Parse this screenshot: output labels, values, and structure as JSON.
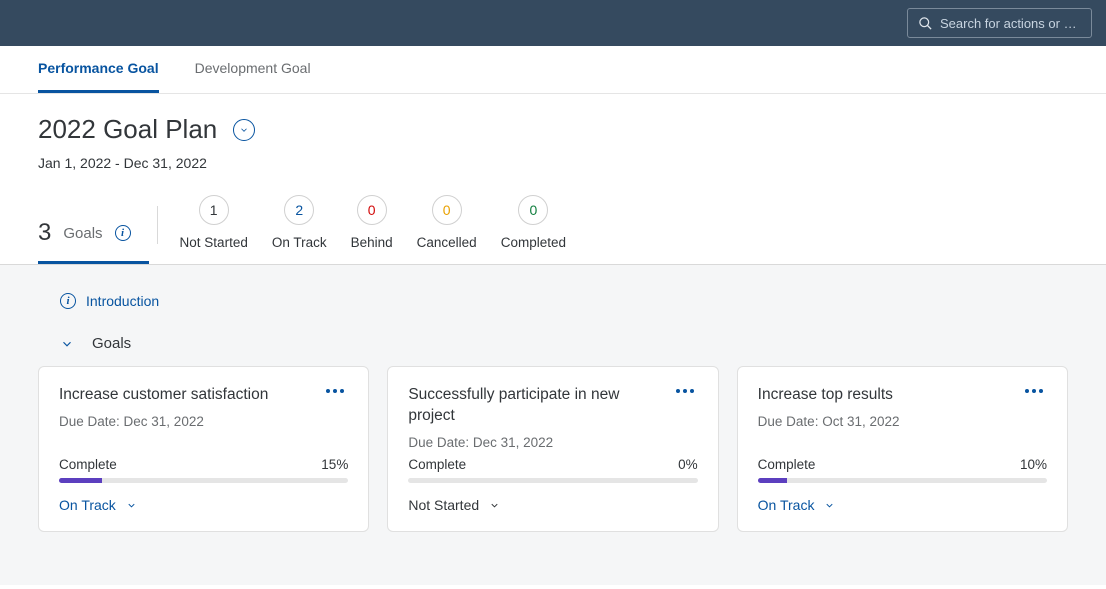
{
  "search": {
    "placeholder": "Search for actions or peo..."
  },
  "tabs": {
    "performance": "Performance Goal",
    "development": "Development Goal"
  },
  "header": {
    "title": "2022 Goal Plan",
    "date_range": "Jan 1, 2022 - Dec 31, 2022"
  },
  "summary": {
    "count": "3",
    "label": "Goals",
    "statuses": [
      {
        "count": "1",
        "label": "Not Started",
        "color": "c-black"
      },
      {
        "count": "2",
        "label": "On Track",
        "color": "c-blue"
      },
      {
        "count": "0",
        "label": "Behind",
        "color": "c-red"
      },
      {
        "count": "0",
        "label": "Cancelled",
        "color": "c-orange"
      },
      {
        "count": "0",
        "label": "Completed",
        "color": "c-green"
      }
    ]
  },
  "intro_label": "Introduction",
  "section_label": "Goals",
  "complete_label": "Complete",
  "cards": [
    {
      "title": "Increase customer satisfaction",
      "due": "Due Date: Dec 31, 2022",
      "percent_text": "15%",
      "percent_value": 15,
      "status": "On Track",
      "status_class": "blue"
    },
    {
      "title": "Successfully participate in new project",
      "due": "Due Date: Dec 31, 2022",
      "percent_text": "0%",
      "percent_value": 0,
      "status": "Not Started",
      "status_class": "black"
    },
    {
      "title": "Increase top results",
      "due": "Due Date: Oct 31, 2022",
      "percent_text": "10%",
      "percent_value": 10,
      "status": "On Track",
      "status_class": "blue"
    }
  ]
}
